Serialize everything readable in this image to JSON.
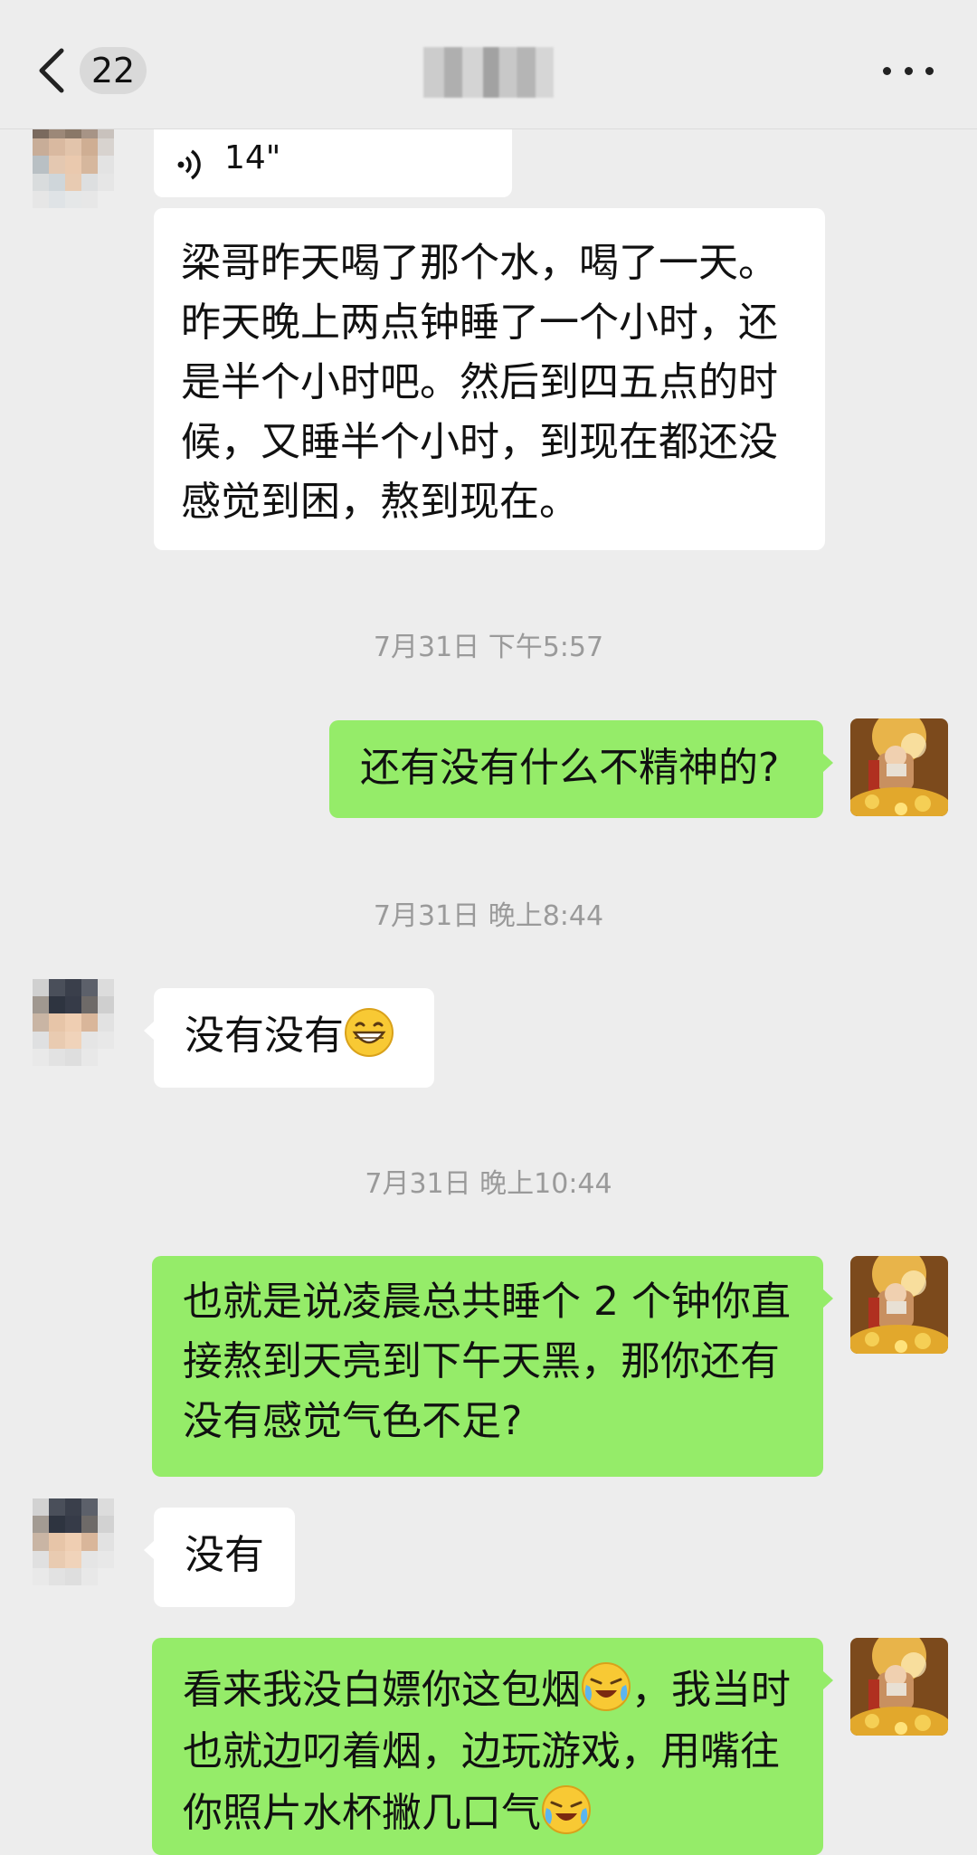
{
  "header": {
    "back_icon": "chevron-left-icon",
    "unread_count": "22",
    "more_icon": "more-dots-icon"
  },
  "messages": {
    "voice": {
      "duration": "14\""
    },
    "m1": {
      "text": "梁哥昨天喝了那个水，喝了一天。昨天晚上两点钟睡了一个小时，还是半个小时吧。然后到四五点的时候，又睡半个小时，到现在都还没感觉到困，熬到现在。"
    },
    "ts1": "7月31日 下午5:57",
    "m2": {
      "text": "还有没有什么不精神的?"
    },
    "ts2": "7月31日 晚上8:44",
    "m3": {
      "text": "没有没有",
      "emoji": "grinning-face-emoji"
    },
    "ts3": "7月31日 晚上10:44",
    "m4": {
      "text": "也就是说凌晨总共睡个 2 个钟你直接熬到天亮到下午天黑，那你还有没有感觉气色不足?"
    },
    "m5": {
      "text": "没有"
    },
    "m6": {
      "part1": "看来我没白嫖你这包烟",
      "part2": "，我当时也就边叼着烟，边玩游戏，用嘴往你照片水杯撇几口气",
      "emoji": "crying-laughing-emoji"
    }
  },
  "colors": {
    "background": "#ededed",
    "own_bubble": "#95ec69",
    "other_bubble": "#ffffff",
    "timestamp": "#9a9a9a"
  }
}
